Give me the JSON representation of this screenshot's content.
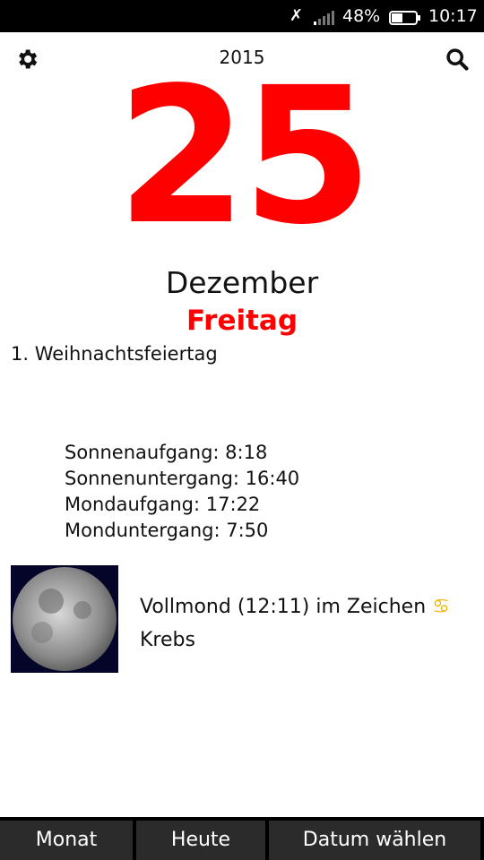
{
  "status": {
    "battery": "48%",
    "time": "10:17"
  },
  "header": {
    "year": "2015"
  },
  "date": {
    "day": "25",
    "month": "Dezember",
    "weekday": "Freitag",
    "holiday": "1. Weihnachtsfeiertag"
  },
  "times": [
    "Sonnenaufgang: 8:18",
    "Sonnenuntergang: 16:40",
    "Mondaufgang: 17:22",
    "Monduntergang: 7:50"
  ],
  "moon": {
    "text": "Vollmond (12:11) im Zeichen",
    "symbol": "♋",
    "sign": "Krebs"
  },
  "nav": {
    "month": "Monat",
    "today": "Heute",
    "choose": "Datum wählen"
  }
}
